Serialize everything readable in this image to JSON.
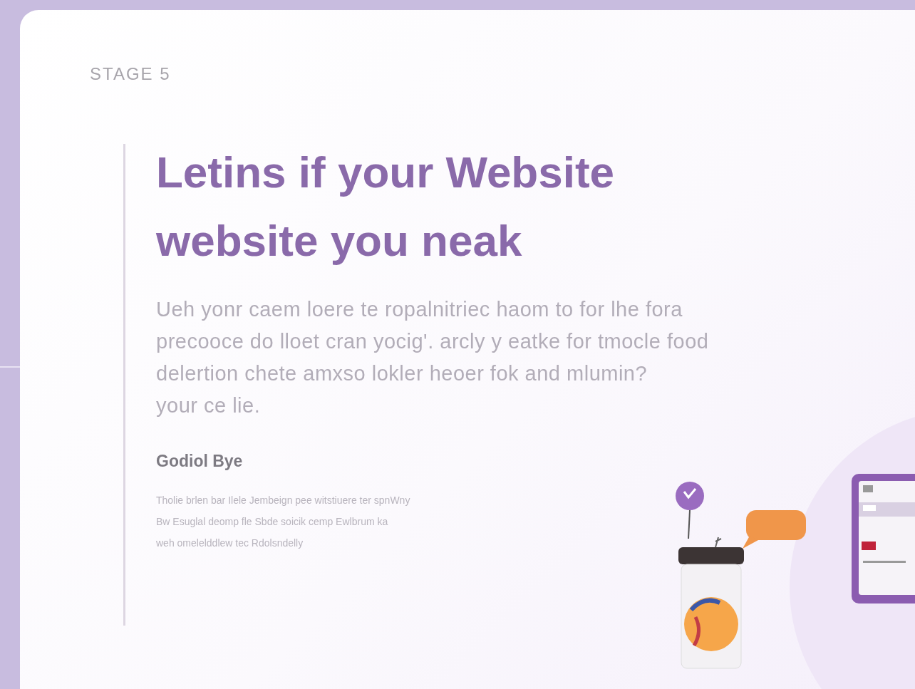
{
  "stage_label": "STAGE 5",
  "heading_lines": [
    "Letins if your Website",
    "website you neak"
  ],
  "body_lines": [
    "Ueh yonr caem loere te ropalnitriec haom to for lhe fora",
    "precooce do lloet cran yocig'. arcly y eatke for tmocle food",
    "delertion chete amxso lokler heoer fok and mlumin?",
    "your ce lie."
  ],
  "subheading": "Godiol Bye",
  "note_lines": [
    "Tholie brlen bar Ilele Jembeign pee witstiuere ter spnWny",
    "Bw Esuglal deomp fle Sbde soicik cemp Ewlbrum ka",
    "weh omelelddlew tec Rdolsndelly"
  ]
}
